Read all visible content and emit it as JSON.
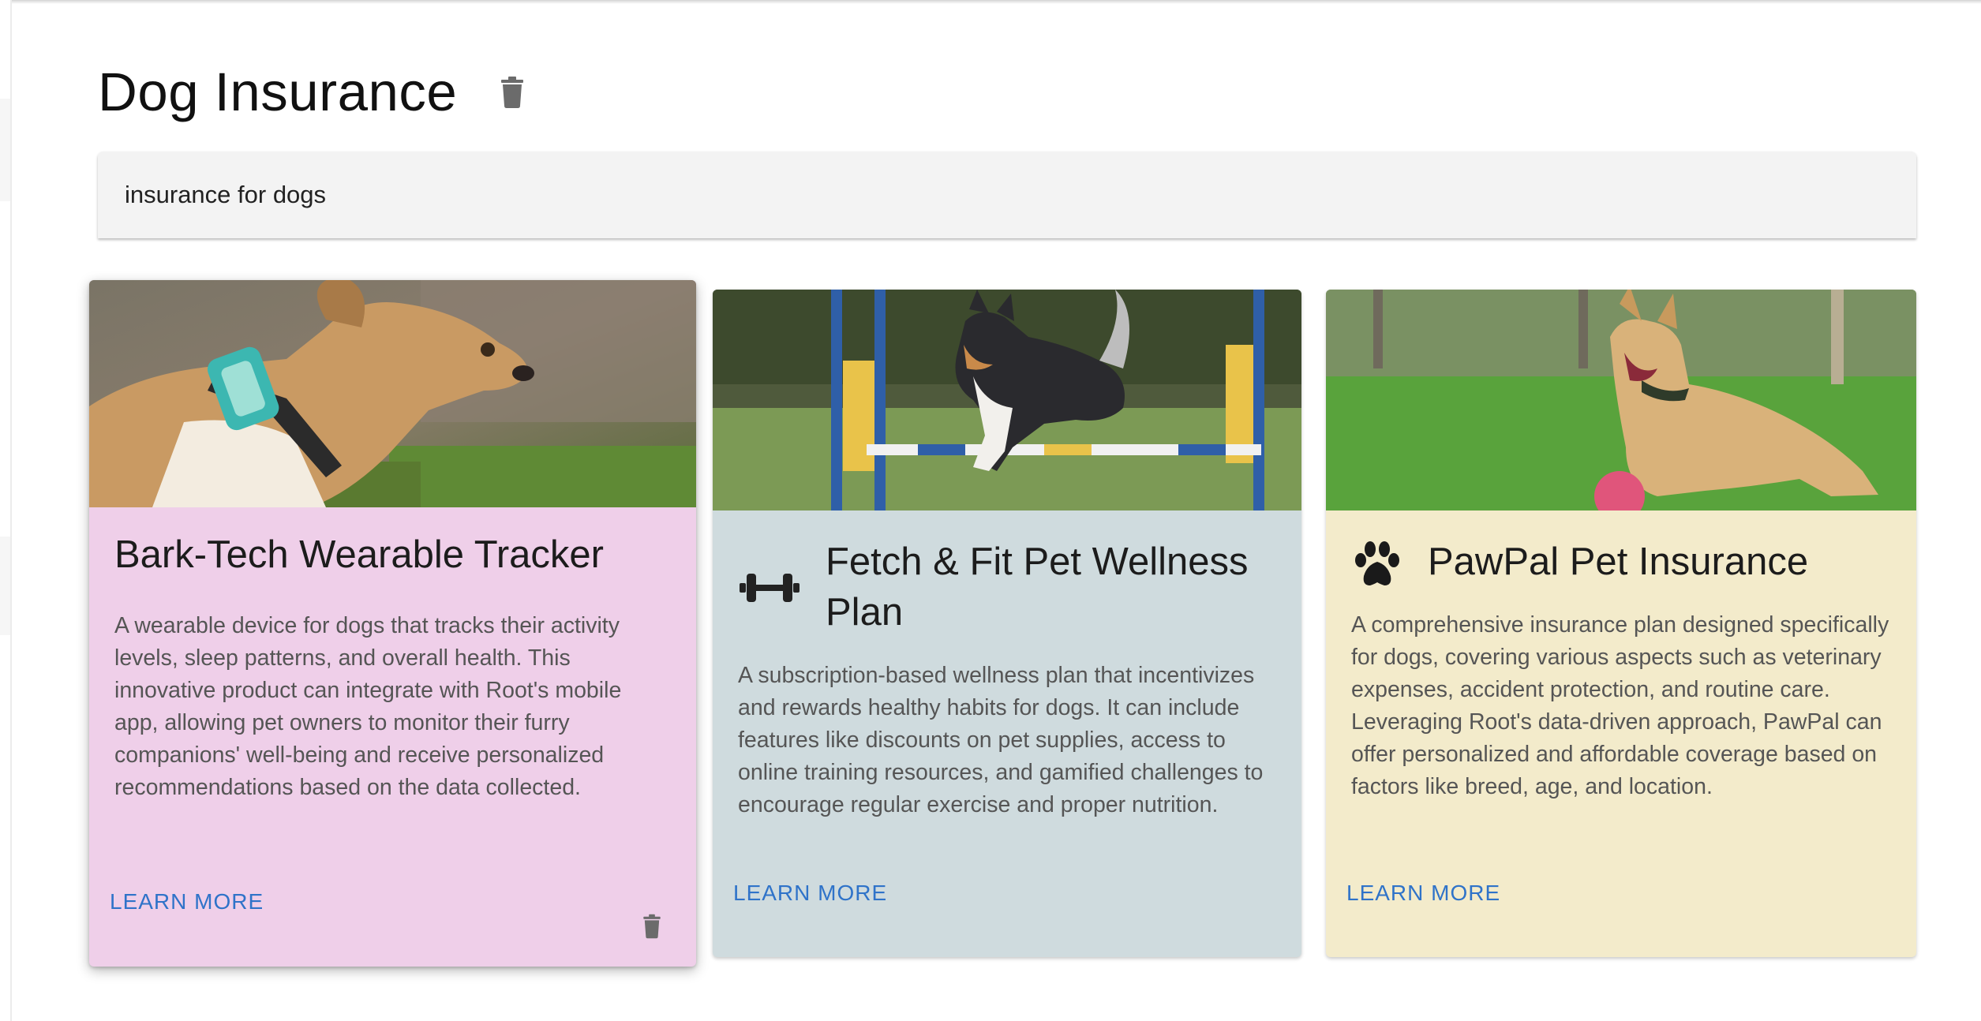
{
  "page": {
    "title": "Dog Insurance",
    "delete_icon": "trash-icon"
  },
  "search": {
    "value": "insurance for dogs"
  },
  "cards": [
    {
      "title": "Bark-Tech Wearable Tracker",
      "description": "A wearable device for dogs that tracks their activity levels, sleep patterns, and overall health. This innovative product can integrate with Root's mobile app, allowing pet owners to monitor their furry companions' well-being and receive personalized recommendations based on the data collected.",
      "action": "LEARN MORE",
      "icon": "",
      "delete_icon": "trash-icon",
      "background": "#efcfe9",
      "image": "dog-wearing-smart-collar-photo"
    },
    {
      "title": "Fetch & Fit Pet Wellness Plan",
      "description": "A subscription-based wellness plan that incentivizes and rewards healthy habits for dogs. It can include features like discounts on pet supplies, access to online training resources, and gamified challenges to encourage regular exercise and proper nutrition.",
      "action": "LEARN MORE",
      "icon": "dumbbell-icon",
      "background": "#cfdbde",
      "image": "dog-agility-jump-photo"
    },
    {
      "title": "PawPal Pet Insurance",
      "description": "A comprehensive insurance plan designed specifically for dogs, covering various aspects such as veterinary expenses, accident protection, and routine care. Leveraging Root's data-driven approach, PawPal can offer personalized and affordable coverage based on factors like breed, age, and location.",
      "action": "LEARN MORE",
      "icon": "paw-icon",
      "background": "#f3ebcb",
      "image": "dog-playing-with-ball-photo"
    }
  ],
  "colors": {
    "link": "#2f73c9",
    "icon": "#6b6b6b"
  }
}
